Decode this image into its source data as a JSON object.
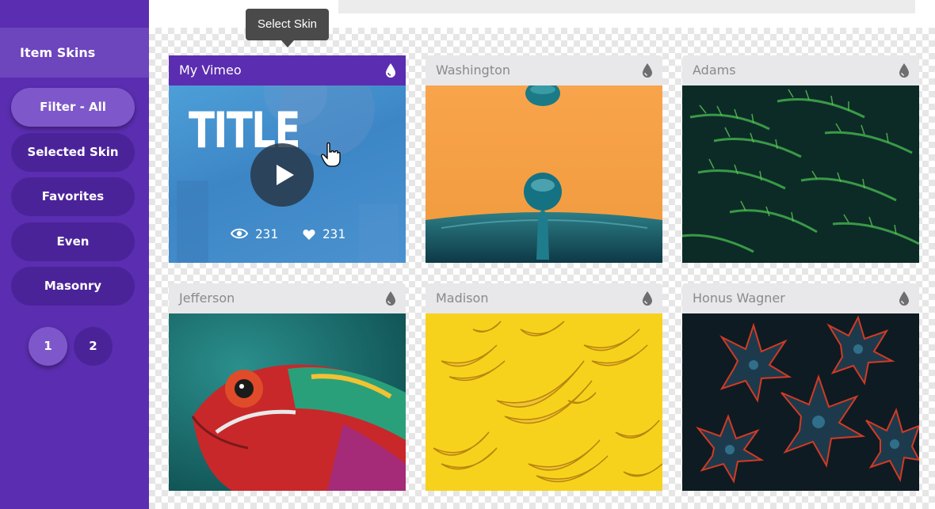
{
  "sidebar": {
    "title": "Item Skins",
    "filters": [
      {
        "label": "Filter - All",
        "active": true
      },
      {
        "label": "Selected Skin",
        "active": false
      },
      {
        "label": "Favorites",
        "active": false
      },
      {
        "label": "Even",
        "active": false
      },
      {
        "label": "Masonry",
        "active": false
      }
    ],
    "pages": [
      {
        "label": "1",
        "active": true
      },
      {
        "label": "2",
        "active": false
      }
    ]
  },
  "tooltip": {
    "text": "Select Skin"
  },
  "cards": [
    {
      "title": "My Vimeo",
      "active": true,
      "icon": "drop-icon"
    },
    {
      "title": "Washington",
      "active": false,
      "icon": "drop-icon"
    },
    {
      "title": "Adams",
      "active": false,
      "icon": "drop-icon"
    },
    {
      "title": "Jefferson",
      "active": false,
      "icon": "drop-icon"
    },
    {
      "title": "Madison",
      "active": false,
      "icon": "drop-icon"
    },
    {
      "title": "Honus Wagner",
      "active": false,
      "icon": "drop-icon"
    }
  ],
  "vimeo": {
    "overlay_title": "TITLE",
    "views": "231",
    "likes": "231"
  },
  "colors": {
    "sidebar_bg": "#5b2db0",
    "sidebar_pill": "#4b2399",
    "sidebar_pill_active": "#7e58cb",
    "card_header": "#e8e7ea",
    "card_header_active": "#5b2db0"
  }
}
